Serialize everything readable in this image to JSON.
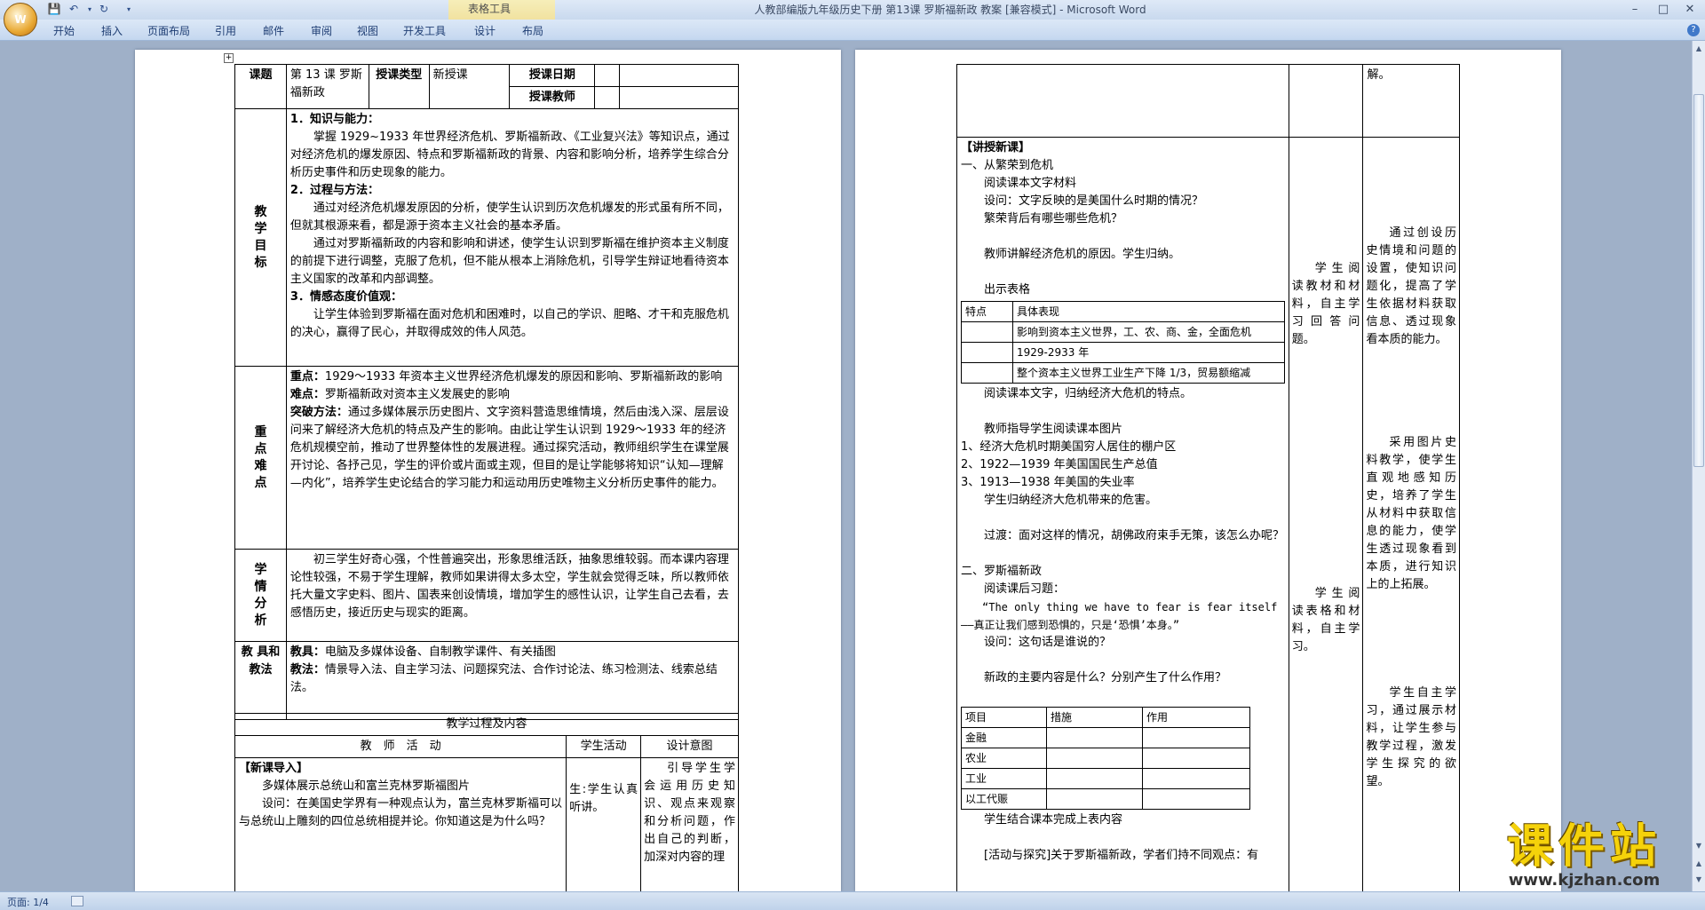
{
  "app": {
    "window_title": "人教部编版九年级历史下册 第13课 罗斯福新政 教案 [兼容模式] - Microsoft Word",
    "context_tab_group": "表格工具",
    "ribbon_tabs": [
      "开始",
      "插入",
      "页面布局",
      "引用",
      "邮件",
      "审阅",
      "视图",
      "开发工具",
      "设计",
      "布局"
    ],
    "status_page": "页面: 1/4",
    "watermark_main": "课件站",
    "watermark_url": "www.kjzhan.com"
  },
  "icons": {
    "office": "office-orb-icon",
    "save": "save-icon",
    "undo": "undo-icon",
    "redo": "redo-icon",
    "minimize": "minimize-icon",
    "maximize": "maximize-icon",
    "close": "close-icon",
    "help": "help-icon"
  },
  "left": {
    "header": {
      "title_label": "课题",
      "title_value": "第 13 课 罗斯福新政",
      "type_label": "授课类型",
      "type_value": "新授课",
      "date_label": "授课日期",
      "teacher_label": "授课教师"
    },
    "goals": {
      "label": [
        "教",
        "学",
        "目",
        "标"
      ],
      "h1": "1．知识与能力：",
      "p1": "掌握 1929~1933 年世界经济危机、罗斯福新政、《工业复兴法》等知识点，通过对经济危机的爆发原因、特点和罗斯福新政的背景、内容和影响分析，培养学生综合分析历史事件和历史现象的能力。",
      "h2": "2．过程与方法：",
      "p2a": "通过对经济危机爆发原因的分析，使学生认识到历次危机爆发的形式虽有所不同，但就其根源来看，都是源于资本主义社会的基本矛盾。",
      "p2b": "通过对罗斯福新政的内容和影响和讲述，使学生认识到罗斯福在维护资本主义制度的前提下进行调整，克服了危机，但不能从根本上消除危机，引导学生辩证地看待资本主义国家的改革和内部调整。",
      "h3": "3．情感态度价值观：",
      "p3": "让学生体验到罗斯福在面对危机和困难时，以自己的学识、胆略、才干和克服危机的决心，赢得了民心，并取得成效的伟人风范。"
    },
    "key": {
      "label": [
        "重",
        "点",
        "难",
        "点"
      ],
      "zd_label": "重点：",
      "zd": "1929～1933 年资本主义世界经济危机爆发的原因和影响、罗斯福新政的影响",
      "nd_label": "难点：",
      "nd": "罗斯福新政对资本主义发展史的影响",
      "tp_label": "突破方法：",
      "tp": "通过多媒体展示历史图片、文字资料营造思维情境，然后由浅入深、层层设问来了解经济大危机的特点及产生的影响。由此让学生认识到 1929～1933 年的经济危机规模空前，推动了世界整体性的发展进程。通过探究活动，教师组织学生在课堂展开讨论、各抒己见，学生的评价或片面或主观，但目的是让学能够将知识“认知—理解—内化”，培养学生史论结合的学习能力和运动用历史唯物主义分析历史事件的能力。"
    },
    "xq": {
      "label": [
        "学",
        "情",
        "分",
        "析"
      ],
      "text": "初三学生好奇心强，个性普遍突出，形象思维活跃，抽象思维较弱。而本课内容理论性较强，不易于学生理解，教师如果讲得太多太空，学生就会觉得乏味，所以教师依托大量文字史料、图片、国表来创设情境，增加学生的感性认识，让学生自己去看，去感悟历史，接近历史与现实的距离。"
    },
    "tools": {
      "label": "教 具和教法",
      "jj_label": "教具：",
      "jj": "电脑及多媒体设备、自制教学课件、有关插图",
      "jf_label": "教法：",
      "jf": "情景导入法、自主学习法、问题探究法、合作讨论法、练习检测法、线索总结法。"
    },
    "process": {
      "title": "教学过程及内容",
      "col_teacher": "教　师　活　动",
      "col_student": "学生活动",
      "col_intent": "设计意图",
      "intro_h": "【新课导入】",
      "intro_p1": "多媒体展示总统山和富兰克林罗斯福图片",
      "intro_p2": "设问：在美国史学界有一种观点认为，富兰克林罗斯福可以与总统山上雕刻的四位总统相提并论。你知道这是为什么吗？",
      "student": "生:学生认真听讲。",
      "intent": "引导学生学会运用历史知识、观点来观察和分析问题，作出自己的判断，加深对内容的理"
    }
  },
  "right": {
    "top_intent": "解。",
    "new_h": "【讲授新课】",
    "s1": "一、从繁荣到危机",
    "s1_l1": "阅读课本文字材料",
    "s1_l2": "设问：文字反映的是美国什么时期的情况？",
    "s1_l3": "繁荣背后有哪些哪些危机？",
    "s1_l4": "教师讲解经济危机的原因。学生归纳。",
    "s1_l5": "出示表格",
    "t1_head": [
      "特点",
      "具体表现"
    ],
    "t1_rows": [
      "影响到资本主义世界，工、农、商、金，全面危机",
      "1929-2933 年",
      "整个资本主义世界工业生产下降 1/3，贸易额缩减"
    ],
    "s1_l6": "阅读课本文字，归纳经济大危机的特点。",
    "s1_l7": "教师指导学生阅读课本图片",
    "s1_l8": "1、经济大危机时期美国穷人居住的棚户区",
    "s1_l9": "2、1922—1939 年美国国民生产总值",
    "s1_l10": "3、1913—1938 年美国的失业率",
    "s1_l11": "学生归纳经济大危机带来的危害。",
    "s1_l12": "过渡：面对这样的情况，胡佛政府束手无策，该怎么办呢？",
    "s2": "二、罗斯福新政",
    "s2_l1": "阅读课后习题：",
    "s2_l2": "“The only thing we have to fear is fear itself——真正让我们感到恐惧的，只是‘恐惧’本身。”",
    "s2_l3": "设问：这句话是谁说的？",
    "s2_l4": "新政的主要内容是什么？分别产生了什么作用？",
    "t2_head": [
      "项目",
      "措施",
      "作用"
    ],
    "t2_rows": [
      "金融",
      "农业",
      "工业",
      "以工代赈"
    ],
    "s2_l5": "学生结合课本完成上表内容",
    "s2_l6": "[活动与探究]关于罗斯福新政，学者们持不同观点：有",
    "student_a": "学生阅读教材和材料，自主学习回答问题。",
    "student_b": "学生阅读表格和材料，自主学习。",
    "intent_a": "通过创设历史情境和问题的设置，使知识问题化，提高了学生依据材料获取信息、透过现象看本质的能力。",
    "intent_b": "采用图片史料教学，使学生直观地感知历史，培养了学生从材料中获取信息的能力，使学生透过现象看到本质，进行知识上的上拓展。",
    "intent_c": "学生自主学习，通过展示材料，让学生参与教学过程，激发学生探究的欲望。"
  }
}
